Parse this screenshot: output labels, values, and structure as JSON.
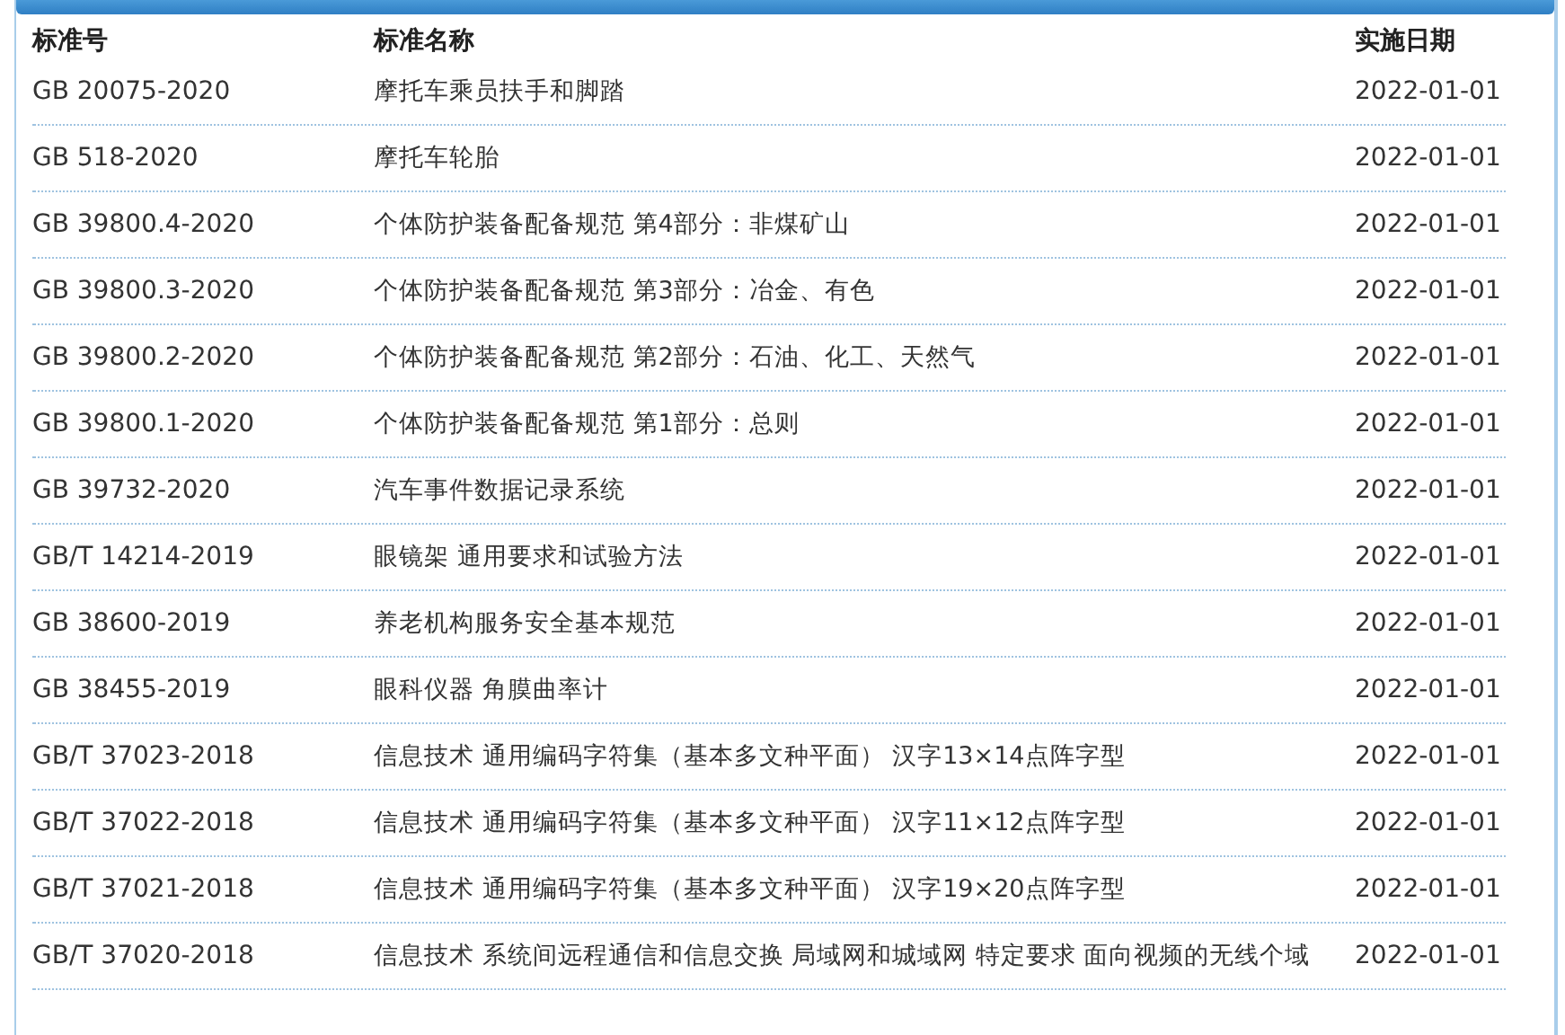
{
  "table": {
    "columns": [
      "标准号",
      "标准名称",
      "实施日期"
    ],
    "rows": [
      [
        "GB 20075-2020",
        "摩托车乘员扶手和脚踏",
        "2022-01-01"
      ],
      [
        "GB 518-2020",
        "摩托车轮胎",
        "2022-01-01"
      ],
      [
        "GB 39800.4-2020",
        "个体防护装备配备规范 第4部分：非煤矿山",
        "2022-01-01"
      ],
      [
        "GB 39800.3-2020",
        "个体防护装备配备规范 第3部分：冶金、有色",
        "2022-01-01"
      ],
      [
        "GB 39800.2-2020",
        "个体防护装备配备规范 第2部分：石油、化工、天然气",
        "2022-01-01"
      ],
      [
        "GB 39800.1-2020",
        "个体防护装备配备规范 第1部分：总则",
        "2022-01-01"
      ],
      [
        "GB 39732-2020",
        "汽车事件数据记录系统",
        "2022-01-01"
      ],
      [
        "GB/T 14214-2019",
        "眼镜架 通用要求和试验方法",
        "2022-01-01"
      ],
      [
        "GB 38600-2019",
        "养老机构服务安全基本规范",
        "2022-01-01"
      ],
      [
        "GB 38455-2019",
        "眼科仪器 角膜曲率计",
        "2022-01-01"
      ],
      [
        "GB/T 37023-2018",
        "信息技术 通用编码字符集（基本多文种平面） 汉字13×14点阵字型",
        "2022-01-01"
      ],
      [
        "GB/T 37022-2018",
        "信息技术 通用编码字符集（基本多文种平面） 汉字11×12点阵字型",
        "2022-01-01"
      ],
      [
        "GB/T 37021-2018",
        "信息技术 通用编码字符集（基本多文种平面） 汉字19×20点阵字型",
        "2022-01-01"
      ],
      [
        "GB/T 37020-2018",
        "信息技术 系统间远程通信和信息交换 局域网和城域网 特定要求 面向视频的无线个域",
        "2022-01-01"
      ]
    ]
  }
}
